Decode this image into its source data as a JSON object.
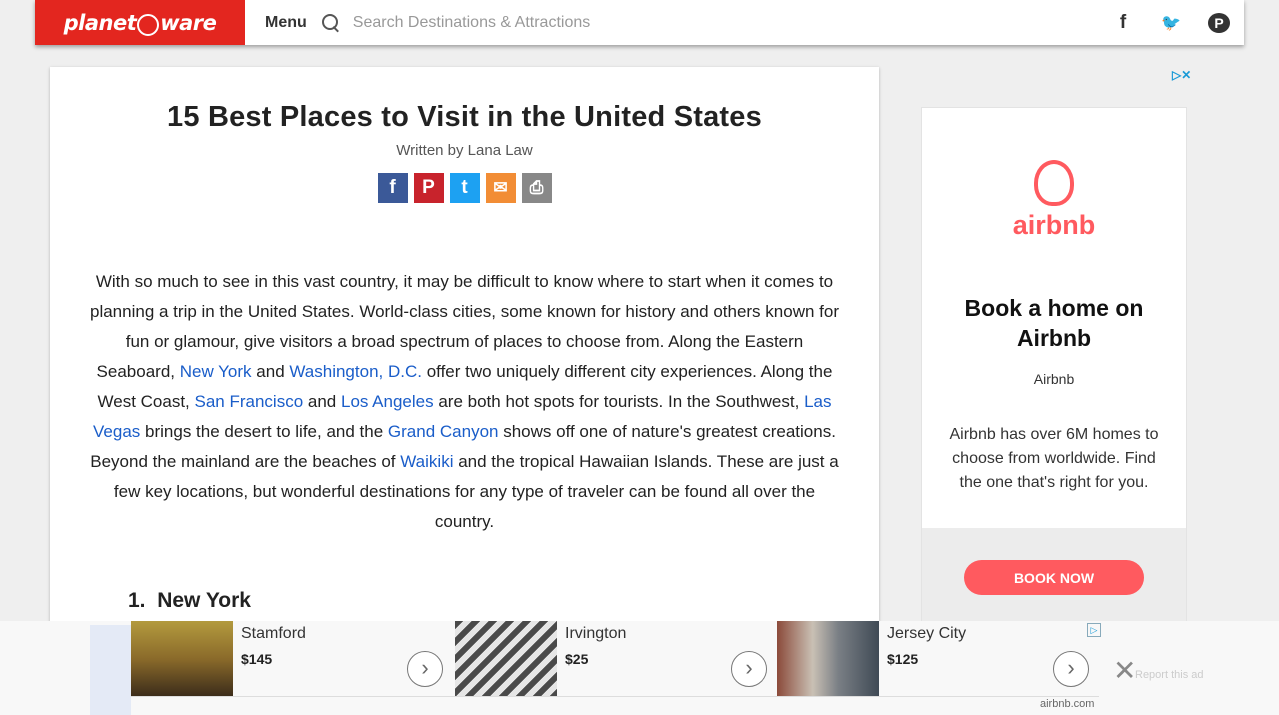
{
  "header": {
    "logo_left": "planet",
    "logo_right": "ware",
    "menu_label": "Menu",
    "search_placeholder": "Search Destinations & Attractions",
    "social": {
      "facebook": "f",
      "twitter": "🐦",
      "pinterest": "P"
    }
  },
  "article": {
    "title": "15 Best Places to Visit in the United States",
    "byline": "Written by Lana Law",
    "share": {
      "facebook": "f",
      "pinterest": "P",
      "twitter": "t",
      "email": "✉",
      "print": "⎙"
    },
    "intro": [
      {
        "t": "With so much to see in this vast country, it may be difficult to know where to start when it comes to planning a trip in the United States. World-class cities, some known for history and others known for fun or glamour, give visitors a broad spectrum of places to choose from. Along the Eastern Seaboard, "
      },
      {
        "t": "New York",
        "link": true
      },
      {
        "t": " and "
      },
      {
        "t": "Washington, D.C.",
        "link": true
      },
      {
        "t": " offer two uniquely different city experiences. Along the West Coast, "
      },
      {
        "t": "San Francisco",
        "link": true
      },
      {
        "t": " and "
      },
      {
        "t": "Los Angeles",
        "link": true
      },
      {
        "t": " are both hot spots for tourists. In the Southwest, "
      },
      {
        "t": "Las Vegas",
        "link": true
      },
      {
        "t": " brings the desert to life, and the "
      },
      {
        "t": "Grand Canyon",
        "link": true
      },
      {
        "t": " shows off one of nature's greatest creations. Beyond the mainland are the beaches of "
      },
      {
        "t": "Waikiki",
        "link": true
      },
      {
        "t": " and the tropical Hawaiian Islands. These are just a few key locations, but wonderful destinations for any type of traveler can be found all over the country."
      }
    ],
    "section_number": "1.",
    "section_title": "New York"
  },
  "sidebar_ad": {
    "brand": "airbnb",
    "headline": "Book a home on Airbnb",
    "advertiser": "Airbnb",
    "description": "Airbnb has over 6M homes to choose from worldwide. Find the one that's right for you.",
    "cta": "BOOK NOW",
    "accent": "#ff5a5f"
  },
  "bottom_ad": {
    "items": [
      {
        "city": "Stamford",
        "price": "$145"
      },
      {
        "city": "Irvington",
        "price": "$25"
      },
      {
        "city": "Jersey City",
        "price": "$125"
      }
    ],
    "source": "airbnb.com",
    "report": "Report this ad"
  },
  "colors": {
    "brand_red": "#e3261f",
    "link_blue": "#1a5dc9"
  }
}
